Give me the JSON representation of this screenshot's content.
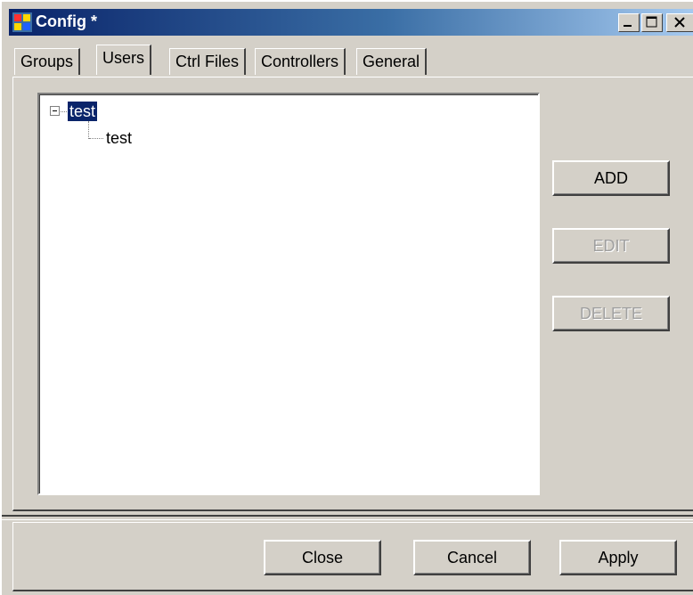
{
  "window": {
    "title": "Config *",
    "icon": "app-config-icon",
    "title_bar_buttons": [
      "minimize-icon",
      "maximize-icon",
      "close-icon"
    ]
  },
  "tabs": [
    {
      "label": "Groups",
      "selected": false
    },
    {
      "label": "Users",
      "selected": true
    },
    {
      "label": "Ctrl Files",
      "selected": false
    },
    {
      "label": "Controllers",
      "selected": false
    },
    {
      "label": "General",
      "selected": false
    }
  ],
  "tree": {
    "root": {
      "label": "test",
      "expanded": true,
      "selected": true
    },
    "children": [
      {
        "label": "test"
      }
    ]
  },
  "actions": {
    "add": {
      "label": "ADD",
      "enabled": true
    },
    "edit": {
      "label": "EDIT",
      "enabled": false
    },
    "delete": {
      "label": "DELETE",
      "enabled": false
    }
  },
  "footer": {
    "close": "Close",
    "cancel": "Cancel",
    "apply": "Apply"
  },
  "colors": {
    "title_bar": "#0a246a",
    "face": "#d4d0c8",
    "selection": "#0a246a"
  }
}
